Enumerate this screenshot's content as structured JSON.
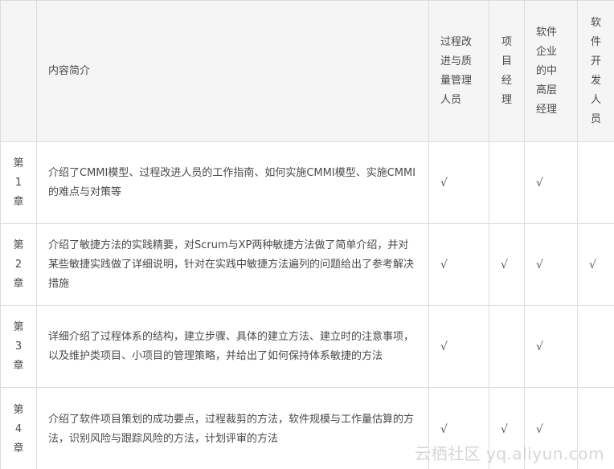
{
  "header": {
    "chapter_col": "",
    "description_col": "内容简介",
    "audiences": [
      "过程改进与质量管理人员",
      "项目经理",
      "软件企业的中高层经理",
      "软件开发人员"
    ]
  },
  "audience_lines": [
    [
      "过程改",
      "进与质",
      "量管理",
      "人员"
    ],
    [
      "项",
      "目",
      "经",
      "理"
    ],
    [
      "软件",
      "企业",
      "的中",
      "高层",
      "经理"
    ],
    [
      "软",
      "件",
      "开",
      "发",
      "人",
      "员"
    ]
  ],
  "rows": [
    {
      "chapter_lines": [
        "第",
        "1",
        "章"
      ],
      "description": "介绍了CMMI模型、过程改进人员的工作指南、如何实施CMMI模型、实施CMMI的难点与对策等",
      "marks": [
        "√",
        "",
        "√",
        ""
      ]
    },
    {
      "chapter_lines": [
        "第",
        "2",
        "章"
      ],
      "description": "介绍了敏捷方法的实践精要，对Scrum与XP两种敏捷方法做了简单介绍，并对某些敏捷实践做了详细说明，针对在实践中敏捷方法遍列的问题给出了参考解决措施",
      "marks": [
        "√",
        "√",
        "√",
        "√"
      ]
    },
    {
      "chapter_lines": [
        "第",
        "3",
        "章"
      ],
      "description": "详细介绍了过程体系的结构，建立步骤、具体的建立方法、建立时的注意事项，以及维护类项目、小项目的管理策略，并给出了如何保持体系敏捷的方法",
      "marks": [
        "√",
        "",
        "√",
        ""
      ]
    },
    {
      "chapter_lines": [
        "第",
        "4",
        "章"
      ],
      "description": "介绍了软件项目策划的成功要点，过程裁剪的方法，软件规模与工作量估算的方法，识别风险与跟踪风险的方法，计划评审的方法",
      "marks": [
        "√",
        "√",
        "√",
        ""
      ]
    }
  ],
  "watermark": "云栖社区 yq.aliyun.com"
}
